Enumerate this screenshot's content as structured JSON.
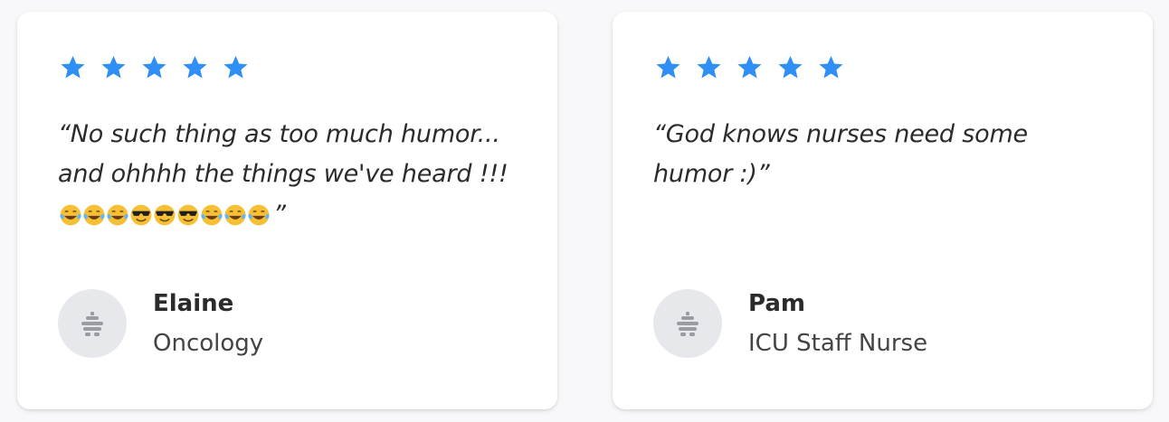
{
  "colors": {
    "star": "#2f8ff5",
    "text": "#2b2b2b",
    "avatar_bg": "#e7e8ec",
    "avatar_icon": "#9a9ca4"
  },
  "testimonials": [
    {
      "rating": 5,
      "quote_line1": "“No such thing as too much humor...",
      "quote_line2": "and ohhhh the things we've heard !!!",
      "quote_emojis": [
        "face-with-tears-of-joy",
        "face-with-tears-of-joy",
        "face-with-tears-of-joy",
        "smiling-face-with-sunglasses",
        "smiling-face-with-sunglasses",
        "smiling-face-with-sunglasses",
        "face-with-tears-of-joy",
        "face-with-tears-of-joy",
        "face-with-tears-of-joy"
      ],
      "quote_end": "”",
      "author_name": "Elaine",
      "author_role": "Oncology",
      "avatar_icon": "beehive-icon"
    },
    {
      "rating": 5,
      "quote_line1": "“God knows nurses need some",
      "quote_line2": "humor :)”",
      "author_name": "Pam",
      "author_role": "ICU Staff Nurse",
      "avatar_icon": "beehive-icon"
    }
  ]
}
